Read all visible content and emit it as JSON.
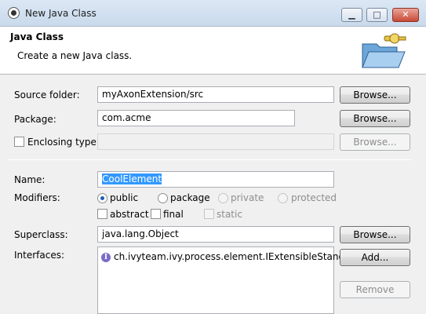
{
  "window": {
    "title": "New Java Class",
    "min_glyph": "▁",
    "max_glyph": "□",
    "close_glyph": "✕"
  },
  "banner": {
    "heading": "Java Class",
    "description": "Create a new Java class."
  },
  "source_folder": {
    "label": "Source folder:",
    "value": "myAxonExtension/src",
    "browse_label": "Browse..."
  },
  "package": {
    "label": "Package:",
    "value": "com.acme",
    "browse_label": "Browse..."
  },
  "enclosing_type": {
    "label": "Enclosing type:",
    "value": "",
    "browse_label": "Browse..."
  },
  "name": {
    "label": "Name:",
    "value": "CoolElement"
  },
  "modifiers": {
    "label": "Modifiers:",
    "access": [
      {
        "label": "public",
        "checked": true,
        "enabled": true
      },
      {
        "label": "package",
        "checked": false,
        "enabled": true
      },
      {
        "label": "private",
        "checked": false,
        "enabled": false
      },
      {
        "label": "protected",
        "checked": false,
        "enabled": false
      }
    ],
    "flags": [
      {
        "label": "abstract",
        "checked": false,
        "enabled": true
      },
      {
        "label": "final",
        "checked": false,
        "enabled": true
      },
      {
        "label": "static",
        "checked": false,
        "enabled": false
      }
    ]
  },
  "superclass": {
    "label": "Superclass:",
    "value": "java.lang.Object",
    "browse_label": "Browse..."
  },
  "interfaces": {
    "label": "Interfaces:",
    "items": [
      "ch.ivyteam.ivy.process.element.IExtensibleStandar..."
    ],
    "icon_glyph": "I",
    "add_label": "Add...",
    "remove_label": "Remove"
  }
}
